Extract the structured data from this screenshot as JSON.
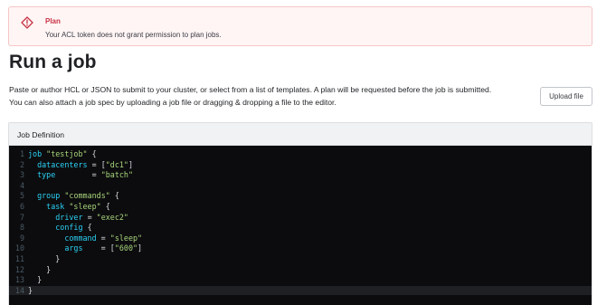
{
  "alert": {
    "title": "Plan",
    "message": "Your ACL token does not grant permission to plan jobs.",
    "icon": "alert-diamond-icon",
    "color": "#c73445"
  },
  "page": {
    "title": "Run a job",
    "description_line1": "Paste or author HCL or JSON to submit to your cluster, or select from a list of templates. A plan will be requested before the job is submitted.",
    "description_line2": "You can also attach a job spec by uploading a job file or dragging & dropping a file to the editor."
  },
  "toolbar": {
    "upload_label": "Upload file"
  },
  "editor": {
    "header_label": "Job Definition",
    "active_line": 14,
    "lines": [
      {
        "n": "1",
        "segments": [
          [
            "kw",
            "job "
          ],
          [
            "str",
            "\"testjob\""
          ],
          [
            "pl",
            " {"
          ]
        ]
      },
      {
        "n": "2",
        "segments": [
          [
            "pl",
            "  "
          ],
          [
            "kw",
            "datacenters"
          ],
          [
            "pl",
            " = ["
          ],
          [
            "str",
            "\"dc1\""
          ],
          [
            "pl",
            "]"
          ]
        ]
      },
      {
        "n": "3",
        "segments": [
          [
            "pl",
            "  "
          ],
          [
            "kw",
            "type"
          ],
          [
            "pl",
            "        = "
          ],
          [
            "str",
            "\"batch\""
          ]
        ]
      },
      {
        "n": "4",
        "segments": []
      },
      {
        "n": "5",
        "segments": [
          [
            "pl",
            "  "
          ],
          [
            "kw",
            "group "
          ],
          [
            "str",
            "\"commands\""
          ],
          [
            "pl",
            " {"
          ]
        ]
      },
      {
        "n": "6",
        "segments": [
          [
            "pl",
            "    "
          ],
          [
            "kw",
            "task "
          ],
          [
            "str",
            "\"sleep\""
          ],
          [
            "pl",
            " {"
          ]
        ]
      },
      {
        "n": "7",
        "segments": [
          [
            "pl",
            "      "
          ],
          [
            "kw",
            "driver"
          ],
          [
            "pl",
            " = "
          ],
          [
            "str",
            "\"exec2\""
          ]
        ]
      },
      {
        "n": "8",
        "segments": [
          [
            "pl",
            "      "
          ],
          [
            "kw",
            "config"
          ],
          [
            "pl",
            " {"
          ]
        ]
      },
      {
        "n": "9",
        "segments": [
          [
            "pl",
            "        "
          ],
          [
            "kw",
            "command"
          ],
          [
            "pl",
            " = "
          ],
          [
            "str",
            "\"sleep\""
          ]
        ]
      },
      {
        "n": "10",
        "segments": [
          [
            "pl",
            "        "
          ],
          [
            "kw",
            "args"
          ],
          [
            "pl",
            "    = ["
          ],
          [
            "str",
            "\"600\""
          ],
          [
            "pl",
            "]"
          ]
        ]
      },
      {
        "n": "11",
        "segments": [
          [
            "pl",
            "      }"
          ]
        ]
      },
      {
        "n": "12",
        "segments": [
          [
            "pl",
            "    }"
          ]
        ]
      },
      {
        "n": "13",
        "segments": [
          [
            "pl",
            "  }"
          ]
        ]
      },
      {
        "n": "14",
        "segments": [
          [
            "pl",
            "}"
          ]
        ]
      }
    ]
  }
}
